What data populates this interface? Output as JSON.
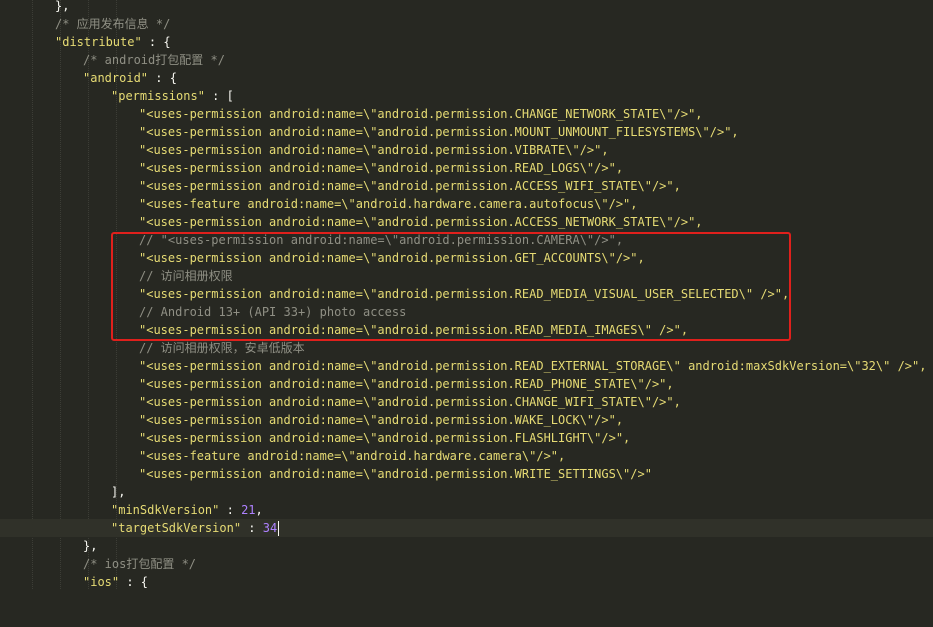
{
  "colors": {
    "background": "#272822",
    "comment": "#8f8f84",
    "string": "#e6db74",
    "number": "#ae81ff",
    "annotation_box": "#e0201c"
  },
  "code": {
    "line_close_brace": "},",
    "comment_app_distribute": "/* 应用发布信息 */",
    "distribute_key": "\"distribute\"",
    "distribute_open": " : {",
    "comment_android_pack": "/* android打包配置 */",
    "android_key": "\"android\"",
    "android_open": " : {",
    "permissions_key": "\"permissions\"",
    "permissions_open": " : [",
    "perm_change_network_state": "\"<uses-permission android:name=\\\"android.permission.CHANGE_NETWORK_STATE\\\"/>\",",
    "perm_mount_unmount": "\"<uses-permission android:name=\\\"android.permission.MOUNT_UNMOUNT_FILESYSTEMS\\\"/>\",",
    "perm_vibrate": "\"<uses-permission android:name=\\\"android.permission.VIBRATE\\\"/>\",",
    "perm_read_logs": "\"<uses-permission android:name=\\\"android.permission.READ_LOGS\\\"/>\",",
    "perm_access_wifi_state": "\"<uses-permission android:name=\\\"android.permission.ACCESS_WIFI_STATE\\\"/>\",",
    "feature_autofocus": "\"<uses-feature android:name=\\\"android.hardware.camera.autofocus\\\"/>\",",
    "perm_access_network_state": "\"<uses-permission android:name=\\\"android.permission.ACCESS_NETWORK_STATE\\\"/>\",",
    "comment_camera": "// \"<uses-permission android:name=\\\"android.permission.CAMERA\\\"/>\",",
    "perm_get_accounts": "\"<uses-permission android:name=\\\"android.permission.GET_ACCOUNTS\\\"/>\",",
    "comment_album_access": "// 访问相册权限",
    "perm_read_media_visual": "\"<uses-permission android:name=\\\"android.permission.READ_MEDIA_VISUAL_USER_SELECTED\\\" />\",",
    "comment_android13": "// Android 13+ (API 33+) photo access",
    "perm_read_media_images": "\"<uses-permission android:name=\\\"android.permission.READ_MEDIA_IMAGES\\\" />\",",
    "comment_album_access_low": "// 访问相册权限，安卓低版本",
    "perm_read_external_storage": "\"<uses-permission android:name=\\\"android.permission.READ_EXTERNAL_STORAGE\\\" android:maxSdkVersion=\\\"32\\\" />\",",
    "perm_read_phone_state": "\"<uses-permission android:name=\\\"android.permission.READ_PHONE_STATE\\\"/>\",",
    "perm_change_wifi_state": "\"<uses-permission android:name=\\\"android.permission.CHANGE_WIFI_STATE\\\"/>\",",
    "perm_wake_lock": "\"<uses-permission android:name=\\\"android.permission.WAKE_LOCK\\\"/>\",",
    "perm_flashlight": "\"<uses-permission android:name=\\\"android.permission.FLASHLIGHT\\\"/>\",",
    "feature_camera": "\"<uses-feature android:name=\\\"android.hardware.camera\\\"/>\",",
    "perm_write_settings": "\"<uses-permission android:name=\\\"android.permission.WRITE_SETTINGS\\\"/>\"",
    "permissions_close": "],",
    "min_sdk_key": "\"minSdkVersion\"",
    "min_sdk_sep": " : ",
    "min_sdk_value": "21",
    "min_sdk_comma": ",",
    "target_sdk_key": "\"targetSdkVersion\"",
    "target_sdk_sep": " : ",
    "target_sdk_value": "34",
    "android_close": "},",
    "comment_ios_pack": "/* ios打包配置 */",
    "ios_key": "\"ios\"",
    "ios_open": " : {"
  }
}
